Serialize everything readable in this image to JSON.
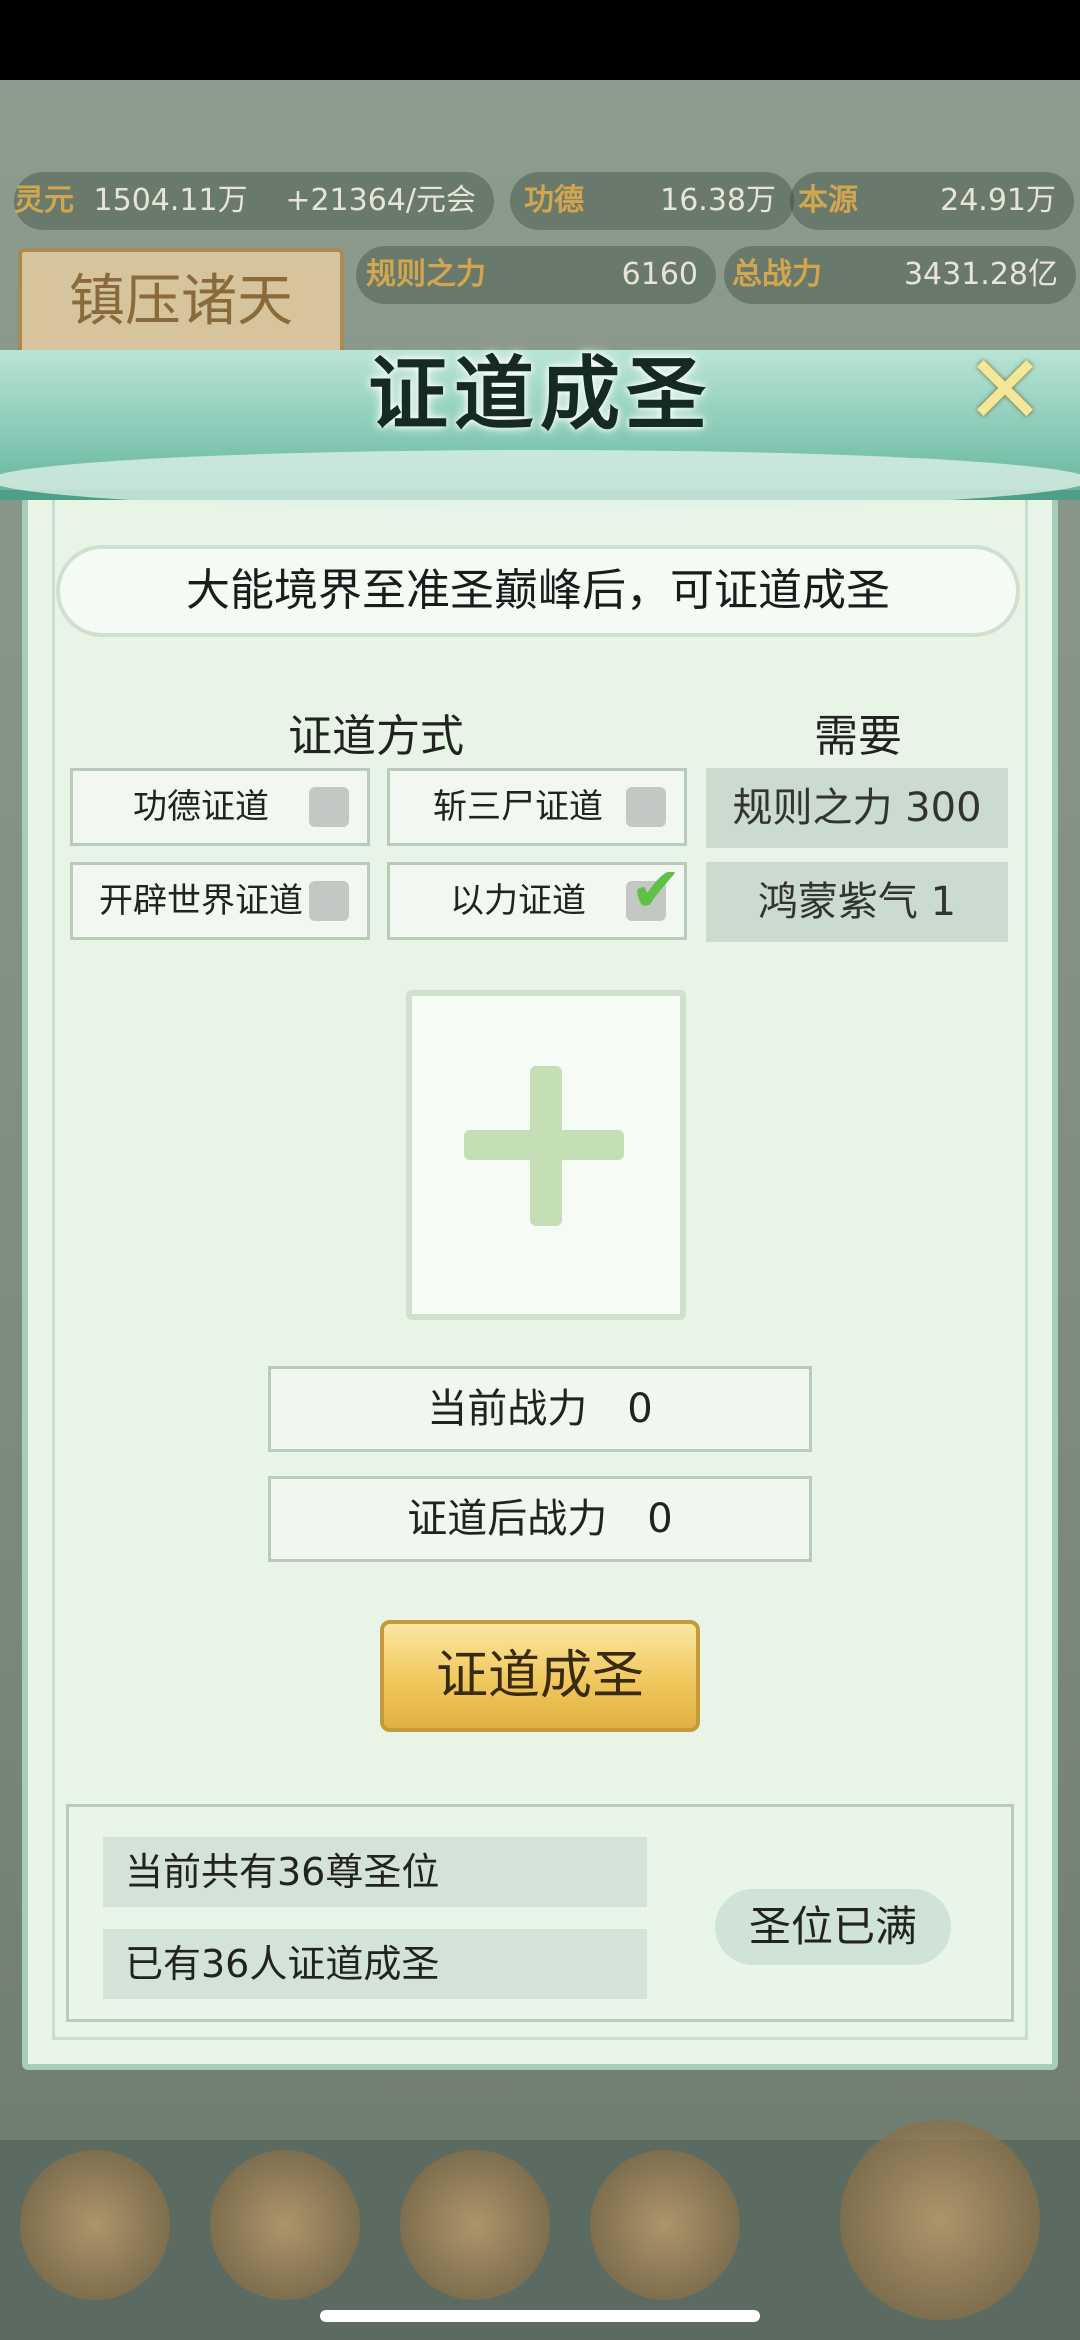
{
  "top_resources": {
    "lingyuan_label": "灵元",
    "lingyuan_value": "1504.11万",
    "lingyuan_rate": "+21364/元会",
    "gongde_label": "功德",
    "gongde_value": "16.38万",
    "benyuan_label": "本源",
    "benyuan_value": "24.91万",
    "guize_label": "规则之力",
    "guize_value": "6160",
    "zongzhanli_label": "总战力",
    "zongzhanli_value": "3431.28亿",
    "plaque": "镇压诸天"
  },
  "dialog": {
    "title": "证道成圣",
    "banner": "大能境界至准圣巅峰后，可证道成圣",
    "methods_header": "证道方式",
    "need_header": "需要",
    "methods": [
      {
        "label": "功德证道",
        "checked": false
      },
      {
        "label": "斩三尸证道",
        "checked": false
      },
      {
        "label": "开辟世界证道",
        "checked": false
      },
      {
        "label": "以力证道",
        "checked": true
      }
    ],
    "needs": [
      "规则之力 300",
      "鸿蒙紫气 1"
    ],
    "current_power": "当前战力　0",
    "after_power": "证道后战力　0",
    "action": "证道成圣",
    "info1": "当前共有36尊圣位",
    "info2": "已有36人证道成圣",
    "status": "圣位已满"
  }
}
